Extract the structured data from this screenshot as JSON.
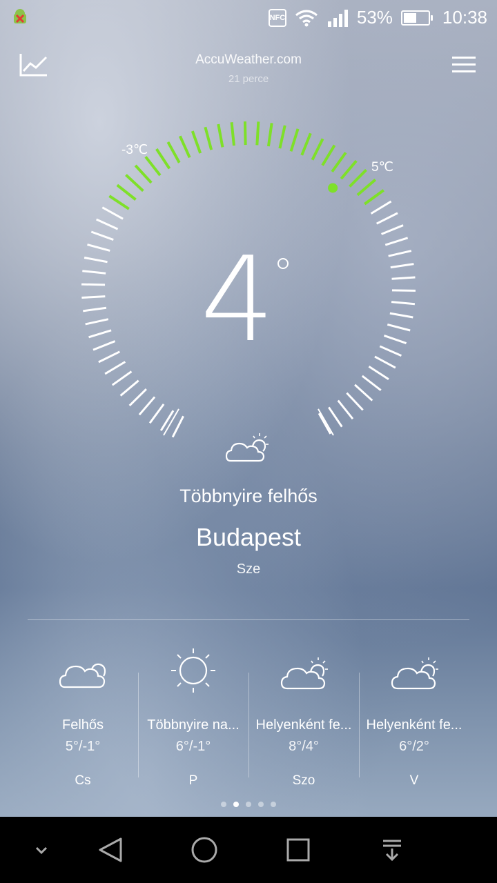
{
  "status": {
    "battery": "53%",
    "time": "10:38",
    "nfc": "NFC",
    "battery_level": 0.53
  },
  "header": {
    "source": "AccuWeather.com",
    "updated": "21 perce"
  },
  "current": {
    "temp": "4",
    "min_label": "-3℃",
    "max_label": "5℃",
    "condition": "Többnyire felhős",
    "city": "Budapest",
    "day": "Sze",
    "accent": "#7ee029"
  },
  "forecast": [
    {
      "icon": "cloud-icon",
      "condition": "Felhős",
      "temps": "5°/-1°",
      "day": "Cs"
    },
    {
      "icon": "sun-icon",
      "condition": "Többnyire na...",
      "temps": "6°/-1°",
      "day": "P"
    },
    {
      "icon": "partly-cloudy-icon",
      "condition": "Helyenként fe...",
      "temps": "8°/4°",
      "day": "Szo"
    },
    {
      "icon": "partly-cloudy-icon",
      "condition": "Helyenként fe...",
      "temps": "6°/2°",
      "day": "V"
    }
  ],
  "pager": {
    "count": 5,
    "active": 1
  },
  "colors": {
    "accent": "#7ee029",
    "text": "#ffffff"
  }
}
